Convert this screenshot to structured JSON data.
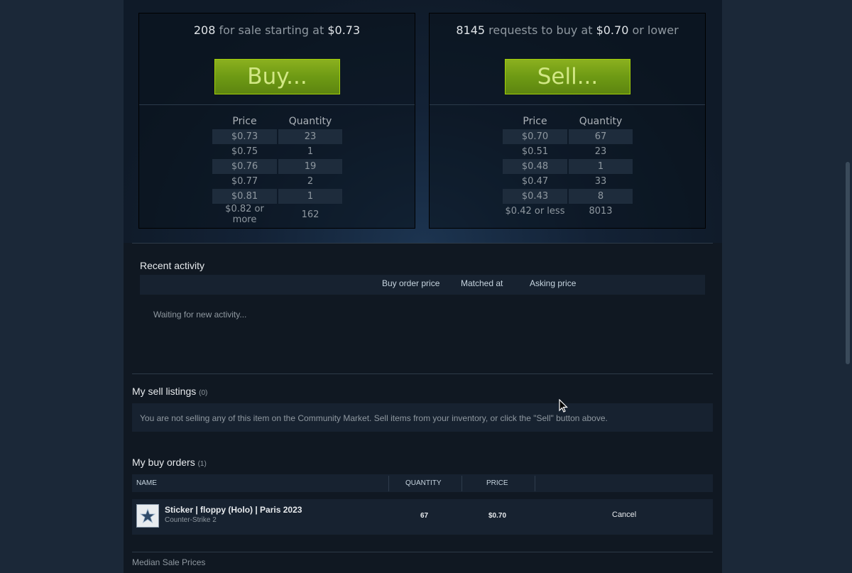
{
  "buy_panel": {
    "count": "208",
    "text_mid": "for sale starting at",
    "price": "$0.73",
    "button_label": "Buy...",
    "col_price": "Price",
    "col_quantity": "Quantity",
    "rows": [
      {
        "price": "$0.73",
        "qty": "23"
      },
      {
        "price": "$0.75",
        "qty": "1"
      },
      {
        "price": "$0.76",
        "qty": "19"
      },
      {
        "price": "$0.77",
        "qty": "2"
      },
      {
        "price": "$0.81",
        "qty": "1"
      },
      {
        "price": "$0.82 or more",
        "qty": "162"
      }
    ]
  },
  "sell_panel": {
    "count": "8145",
    "text_mid": "requests to buy at",
    "price": "$0.70",
    "text_end": "or lower",
    "button_label": "Sell...",
    "col_price": "Price",
    "col_quantity": "Quantity",
    "rows": [
      {
        "price": "$0.70",
        "qty": "67"
      },
      {
        "price": "$0.51",
        "qty": "23"
      },
      {
        "price": "$0.48",
        "qty": "1"
      },
      {
        "price": "$0.47",
        "qty": "33"
      },
      {
        "price": "$0.43",
        "qty": "8"
      },
      {
        "price": "$0.42 or less",
        "qty": "8013"
      }
    ]
  },
  "recent_activity": {
    "title": "Recent activity",
    "col_buy_order": "Buy order price",
    "col_matched": "Matched at",
    "col_asking": "Asking price",
    "waiting": "Waiting for new activity..."
  },
  "sell_listings": {
    "title": "My sell listings",
    "count": "(0)",
    "message": "You are not selling any of this item on the Community Market. Sell items from your inventory, or click the \"Sell\" button above."
  },
  "buy_orders": {
    "title": "My buy orders",
    "count": "(1)",
    "col_name": "NAME",
    "col_quantity": "QUANTITY",
    "col_price": "PRICE",
    "item": {
      "name": "Sticker | floppy (Holo) | Paris 2023",
      "game": "Counter-Strike 2",
      "quantity": "67",
      "price": "$0.70",
      "icon": "sticker-star-icon"
    },
    "cancel_label": "Cancel"
  },
  "median": {
    "title": "Median Sale Prices"
  },
  "colors": {
    "page_bg": "#1b2838",
    "content_bg": "#101822",
    "button_green": "#6e9a14",
    "button_text": "#d2e885"
  }
}
